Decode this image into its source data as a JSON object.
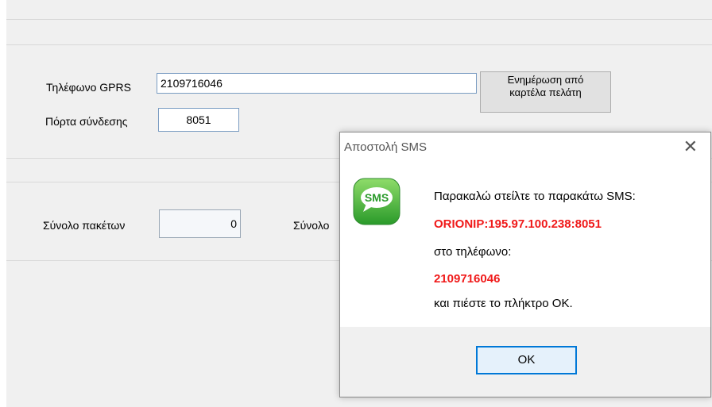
{
  "form": {
    "gprs_phone_label": "Τηλέφωνο GPRS",
    "gprs_phone_value": "2109716046",
    "port_label": "Πόρτα σύνδεσης",
    "port_value": "8051",
    "update_button_line1": "Ενημέρωση από",
    "update_button_line2": "καρτέλα πελάτη",
    "total_packets_label": "Σύνολο πακέτων",
    "total_packets_value": "0",
    "total_label_partial": "Σύνολο"
  },
  "dialog": {
    "title": "Αποστολή SMS",
    "icon_text": "SMS",
    "line1": "Παρακαλώ στείλτε το παρακάτω SMS:",
    "sms_content": "ORIONIP:195.97.100.238:8051",
    "line3": "στο τηλέφωνο:",
    "phone": "2109716046",
    "line5": "και πιέστε το πλήκτρο OK.",
    "ok_label": "OK"
  },
  "colors": {
    "highlight": "#f01a1a",
    "focus_border": "#0078d7",
    "sms_icon_green": "#3db33d"
  }
}
